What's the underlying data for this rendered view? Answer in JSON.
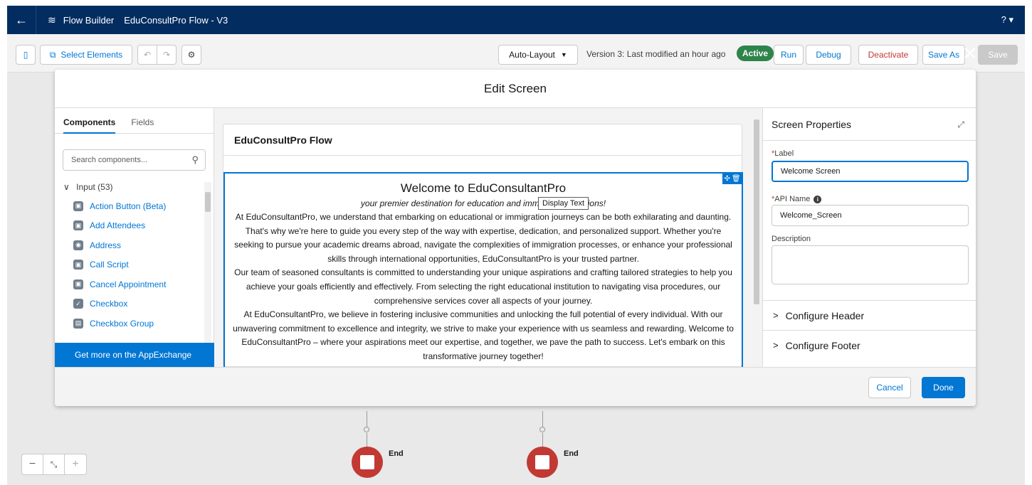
{
  "app_bar": {
    "app_name": "Flow Builder",
    "flow_name": "EduConsultPro Flow - V3",
    "help_label": "? ▾"
  },
  "toolbar": {
    "select_elements_label": "Select Elements",
    "layout_label": "Auto-Layout",
    "version_text": "Version 3: Last modified an hour ago",
    "status_badge": "Active",
    "run_label": "Run",
    "debug_label": "Debug",
    "deactivate_label": "Deactivate",
    "save_as_label": "Save As",
    "save_label": "Save"
  },
  "canvas": {
    "end_labels": [
      "End",
      "End"
    ]
  },
  "modal": {
    "title": "Edit Screen",
    "left_panel": {
      "tabs": [
        "Components",
        "Fields"
      ],
      "search_placeholder": "Search components...",
      "group_label": "Input (53)",
      "components": [
        {
          "label": "Action Button (Beta)",
          "icon": "action-icon"
        },
        {
          "label": "Add Attendees",
          "icon": "add-icon"
        },
        {
          "label": "Address",
          "icon": "address-icon"
        },
        {
          "label": "Call Script",
          "icon": "script-icon"
        },
        {
          "label": "Cancel Appointment",
          "icon": "cancel-icon"
        },
        {
          "label": "Checkbox",
          "icon": "checkbox-icon"
        },
        {
          "label": "Checkbox Group",
          "icon": "checkbox-group-icon"
        }
      ],
      "appexchange_label": "Get more on the AppExchange"
    },
    "canvas": {
      "screen_title": "EduConsultPro Flow",
      "display_text": {
        "heading": "Welcome to EduConsultantPro",
        "subheading": "your premier destination for education and immigration solutions!",
        "paragraphs": [
          "At EduConsultantPro, we understand that embarking on educational or immigration journeys can be both exhilarating and daunting. That's why we're here to guide you every step of the way with expertise, dedication, and personalized support. Whether you're seeking to pursue your academic dreams abroad, navigate the complexities of immigration processes, or enhance your professional skills through international opportunities, EduConsultantPro is your trusted partner.",
          "Our team of seasoned consultants is committed to understanding your unique aspirations and crafting tailored strategies to help you achieve your goals efficiently and effectively. From selecting the right educational institution to navigating visa procedures, our comprehensive services cover all aspects of your journey.",
          "At EduConsultantPro, we believe in fostering inclusive communities and unlocking the full potential of every individual. With our unwavering commitment to excellence and integrity, we strive to make your experience with us seamless and rewarding. Welcome to EduConsultantPro – where your aspirations meet our expertise, and together, we pave the path to success. Let's embark on this transformative journey together!"
        ]
      },
      "tooltip": "Display Text"
    },
    "right_panel": {
      "title": "Screen Properties",
      "label_field_label": "Label",
      "label_value": "Welcome Screen",
      "api_name_label": "API Name",
      "api_name_value": "Welcome_Screen",
      "description_label": "Description",
      "description_value": "",
      "configure_header": "Configure Header",
      "configure_footer": "Configure Footer"
    },
    "footer": {
      "cancel_label": "Cancel",
      "done_label": "Done"
    }
  },
  "colors": {
    "brand_blue": "#0176d3",
    "app_bar_navy": "#032d60",
    "active_green": "#2e844a",
    "end_red": "#c23934"
  }
}
